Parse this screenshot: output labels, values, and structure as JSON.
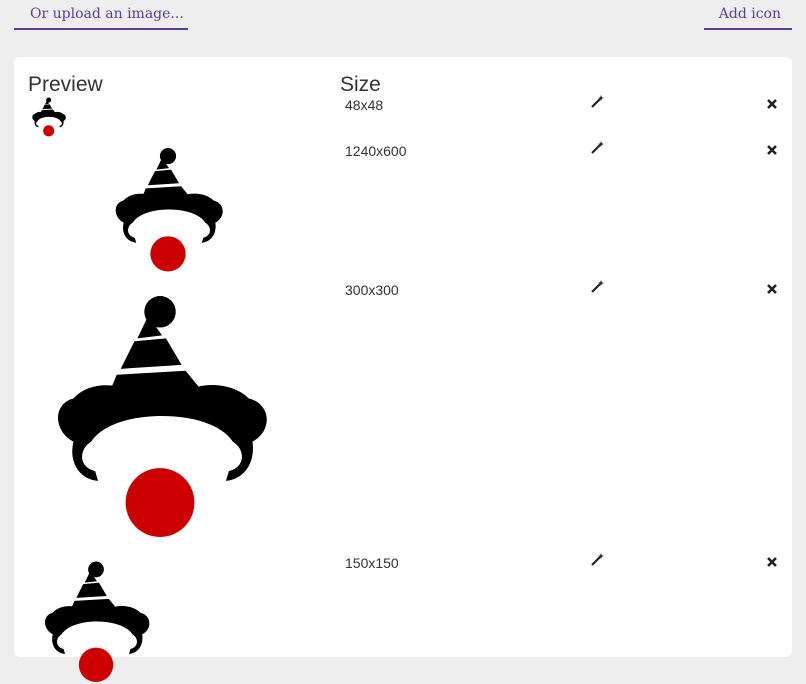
{
  "toolbar": {
    "upload_label": "Or upload an image...",
    "add_icon_label": "Add icon"
  },
  "table": {
    "preview_header": "Preview",
    "size_header": "Size"
  },
  "icons": [
    {
      "size": "48x48"
    },
    {
      "size": "1240x600"
    },
    {
      "size": "300x300"
    },
    {
      "size": "150x150"
    }
  ],
  "colors": {
    "accent": "#5b3f94",
    "nose": "#cc0000",
    "hat": "#000000"
  },
  "icon_names": {
    "edit": "magic-wand-icon",
    "remove": "close-icon"
  }
}
